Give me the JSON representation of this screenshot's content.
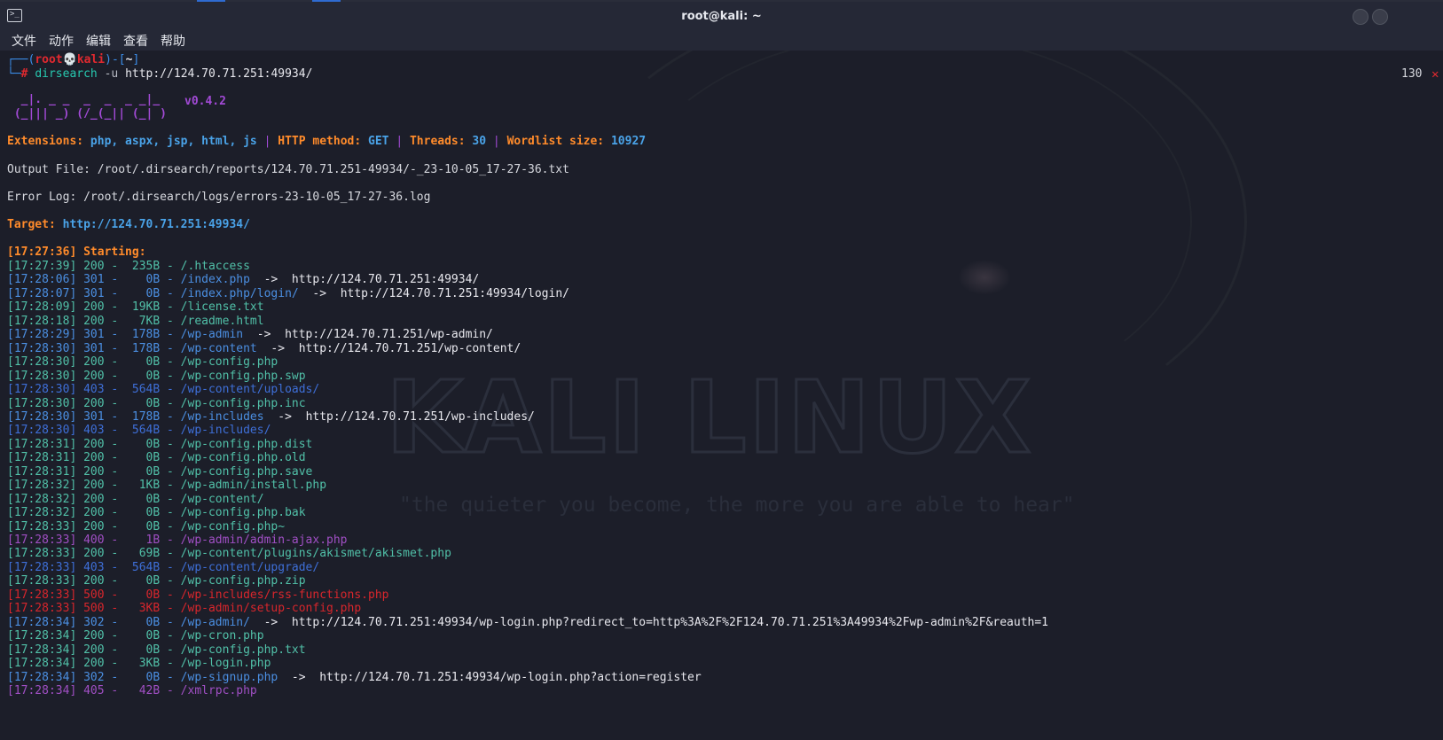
{
  "window": {
    "title": "root@kali: ~"
  },
  "menu": [
    "文件",
    "动作",
    "编辑",
    "查看",
    "帮助"
  ],
  "watermark": {
    "word": "KALI LINUX",
    "quote": "\"the quieter you become, the more you are able to hear\""
  },
  "prompt": {
    "p1": "┌──(",
    "user": "root",
    "skull": "💀",
    "host": "kali",
    "p2": ")-[",
    "dir": "~",
    "p3": "]",
    "p4": "└─",
    "hash": "#",
    "cmd": "dirsearch",
    "flag": "-u",
    "url": "http://124.70.71.251:49934/",
    "exit_code": "130",
    "exit_mark": "✕"
  },
  "banner": {
    "l1": "  _|. _ _  _  _  _ _|_",
    "l2": " (_||| _) (/_(_|| (_| )",
    "version": "v0.4.2"
  },
  "config": {
    "ext_label": "Extensions:",
    "ext_value": "php, aspx, jsp, html, js",
    "sep": "|",
    "method_label": "HTTP method:",
    "method_value": "GET",
    "threads_label": "Threads:",
    "threads_value": "30",
    "wordlist_label": "Wordlist size:",
    "wordlist_value": "10927"
  },
  "output_file": "Output File: /root/.dirsearch/reports/124.70.71.251-49934/-_23-10-05_17-27-36.txt",
  "error_log": "Error Log: /root/.dirsearch/logs/errors-23-10-05_17-27-36.log",
  "target": {
    "label": "Target:",
    "url": "http://124.70.71.251:49934/"
  },
  "starting": "[17:27:36] Starting:",
  "results": [
    {
      "time": "[17:27:39]",
      "status": "200",
      "size": "235B",
      "path": "/.htaccess",
      "redirect": ""
    },
    {
      "time": "[17:28:06]",
      "status": "301",
      "size": "0B",
      "path": "/index.php",
      "redirect": "http://124.70.71.251:49934/"
    },
    {
      "time": "[17:28:07]",
      "status": "301",
      "size": "0B",
      "path": "/index.php/login/",
      "redirect": "http://124.70.71.251:49934/login/"
    },
    {
      "time": "[17:28:09]",
      "status": "200",
      "size": "19KB",
      "path": "/license.txt",
      "redirect": ""
    },
    {
      "time": "[17:28:18]",
      "status": "200",
      "size": "7KB",
      "path": "/readme.html",
      "redirect": ""
    },
    {
      "time": "[17:28:29]",
      "status": "301",
      "size": "178B",
      "path": "/wp-admin",
      "redirect": "http://124.70.71.251/wp-admin/"
    },
    {
      "time": "[17:28:30]",
      "status": "301",
      "size": "178B",
      "path": "/wp-content",
      "redirect": "http://124.70.71.251/wp-content/"
    },
    {
      "time": "[17:28:30]",
      "status": "200",
      "size": "0B",
      "path": "/wp-config.php",
      "redirect": ""
    },
    {
      "time": "[17:28:30]",
      "status": "200",
      "size": "0B",
      "path": "/wp-config.php.swp",
      "redirect": ""
    },
    {
      "time": "[17:28:30]",
      "status": "403",
      "size": "564B",
      "path": "/wp-content/uploads/",
      "redirect": ""
    },
    {
      "time": "[17:28:30]",
      "status": "200",
      "size": "0B",
      "path": "/wp-config.php.inc",
      "redirect": ""
    },
    {
      "time": "[17:28:30]",
      "status": "301",
      "size": "178B",
      "path": "/wp-includes",
      "redirect": "http://124.70.71.251/wp-includes/"
    },
    {
      "time": "[17:28:30]",
      "status": "403",
      "size": "564B",
      "path": "/wp-includes/",
      "redirect": ""
    },
    {
      "time": "[17:28:31]",
      "status": "200",
      "size": "0B",
      "path": "/wp-config.php.dist",
      "redirect": ""
    },
    {
      "time": "[17:28:31]",
      "status": "200",
      "size": "0B",
      "path": "/wp-config.php.old",
      "redirect": ""
    },
    {
      "time": "[17:28:31]",
      "status": "200",
      "size": "0B",
      "path": "/wp-config.php.save",
      "redirect": ""
    },
    {
      "time": "[17:28:32]",
      "status": "200",
      "size": "1KB",
      "path": "/wp-admin/install.php",
      "redirect": ""
    },
    {
      "time": "[17:28:32]",
      "status": "200",
      "size": "0B",
      "path": "/wp-content/",
      "redirect": ""
    },
    {
      "time": "[17:28:32]",
      "status": "200",
      "size": "0B",
      "path": "/wp-config.php.bak",
      "redirect": ""
    },
    {
      "time": "[17:28:33]",
      "status": "200",
      "size": "0B",
      "path": "/wp-config.php~",
      "redirect": ""
    },
    {
      "time": "[17:28:33]",
      "status": "400",
      "size": "1B",
      "path": "/wp-admin/admin-ajax.php",
      "redirect": ""
    },
    {
      "time": "[17:28:33]",
      "status": "200",
      "size": "69B",
      "path": "/wp-content/plugins/akismet/akismet.php",
      "redirect": ""
    },
    {
      "time": "[17:28:33]",
      "status": "403",
      "size": "564B",
      "path": "/wp-content/upgrade/",
      "redirect": ""
    },
    {
      "time": "[17:28:33]",
      "status": "200",
      "size": "0B",
      "path": "/wp-config.php.zip",
      "redirect": ""
    },
    {
      "time": "[17:28:33]",
      "status": "500",
      "size": "0B",
      "path": "/wp-includes/rss-functions.php",
      "redirect": ""
    },
    {
      "time": "[17:28:33]",
      "status": "500",
      "size": "3KB",
      "path": "/wp-admin/setup-config.php",
      "redirect": ""
    },
    {
      "time": "[17:28:34]",
      "status": "302",
      "size": "0B",
      "path": "/wp-admin/",
      "redirect": "http://124.70.71.251:49934/wp-login.php?redirect_to=http%3A%2F%2F124.70.71.251%3A49934%2Fwp-admin%2F&reauth=1"
    },
    {
      "time": "[17:28:34]",
      "status": "200",
      "size": "0B",
      "path": "/wp-cron.php",
      "redirect": ""
    },
    {
      "time": "[17:28:34]",
      "status": "200",
      "size": "0B",
      "path": "/wp-config.php.txt",
      "redirect": ""
    },
    {
      "time": "[17:28:34]",
      "status": "200",
      "size": "3KB",
      "path": "/wp-login.php",
      "redirect": ""
    },
    {
      "time": "[17:28:34]",
      "status": "302",
      "size": "0B",
      "path": "/wp-signup.php",
      "redirect": "http://124.70.71.251:49934/wp-login.php?action=register"
    },
    {
      "time": "[17:28:34]",
      "status": "405",
      "size": "42B",
      "path": "/xmlrpc.php",
      "redirect": ""
    }
  ],
  "arrow": "->",
  "dash": "-",
  "colors": {
    "bg": "#1c1e29",
    "s200": "#51c0a8",
    "s301": "#4b8fe2",
    "s403": "#3e6fd8",
    "s400": "#a04fc4",
    "s500": "#d8262c",
    "accent": "#ff8b2b"
  }
}
